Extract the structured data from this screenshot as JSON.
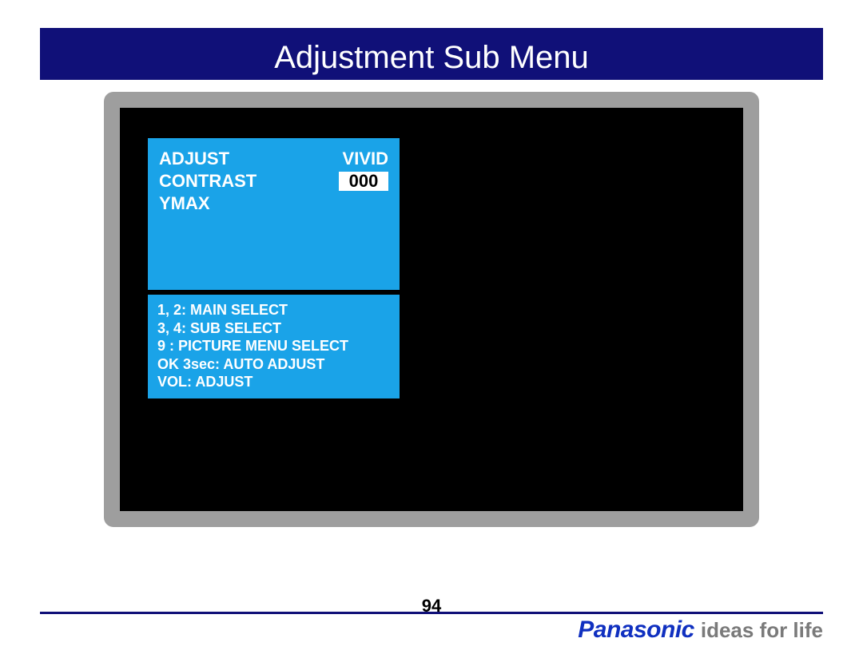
{
  "title": "Adjustment Sub Menu",
  "osd": {
    "rows": [
      {
        "label": "ADJUST",
        "value": "VIVID",
        "boxed": false
      },
      {
        "label": "CONTRAST",
        "value": "000",
        "boxed": true
      },
      {
        "label": "YMAX",
        "value": "",
        "boxed": false
      }
    ],
    "help": [
      "1, 2: MAIN SELECT",
      "3, 4: SUB SELECT",
      "9 : PICTURE MENU SELECT",
      "OK 3sec: AUTO ADJUST",
      "VOL: ADJUST"
    ]
  },
  "page_number": "94",
  "brand": {
    "name": "Panasonic",
    "tagline": "ideas for life"
  }
}
